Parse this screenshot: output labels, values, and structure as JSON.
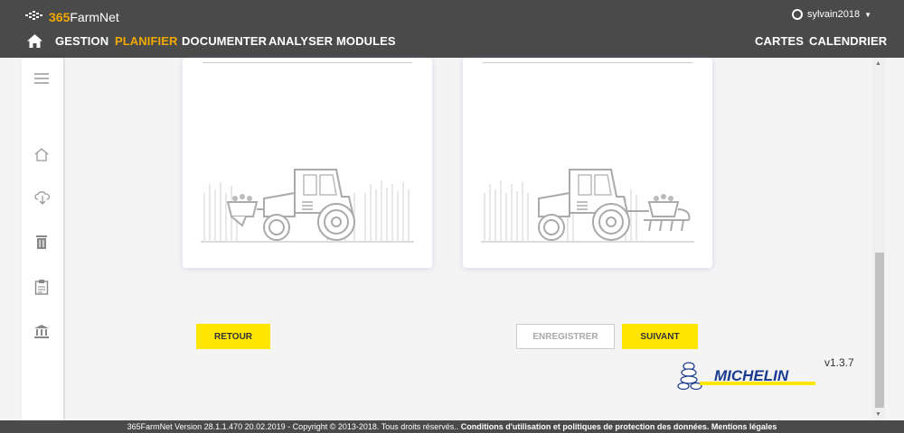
{
  "header": {
    "logo_text_brand": "365",
    "logo_text_rest": "FarmNet",
    "user": "sylvain2018"
  },
  "nav": {
    "items": [
      "GESTION",
      "PLANIFIER",
      "DOCUMENTER",
      "ANALYSER",
      "MODULES"
    ],
    "active": "PLANIFIER",
    "right_items": [
      "CARTES",
      "CALENDRIER"
    ]
  },
  "sidebar": {
    "icons": [
      "menu-icon",
      "home-icon",
      "cloud-download-icon",
      "trash-icon",
      "clipboard-icon",
      "bank-icon"
    ]
  },
  "buttons": {
    "back": "RETOUR",
    "save": "ENREGISTRER",
    "next": "SUIVANT"
  },
  "version": "v1.3.7",
  "brand_logo": "MICHELIN",
  "footer": {
    "text": "365FarmNet Version 28.1.1.470 20.02.2019 - Copyright © 2013-2018. Tous droits réservés.. ",
    "links": "Conditions d'utilisation et politiques de protection des données. Mentions légales"
  },
  "colors": {
    "accent": "#f2a900",
    "button_yellow": "#ffe600",
    "header_bg": "#4a4a4a"
  }
}
